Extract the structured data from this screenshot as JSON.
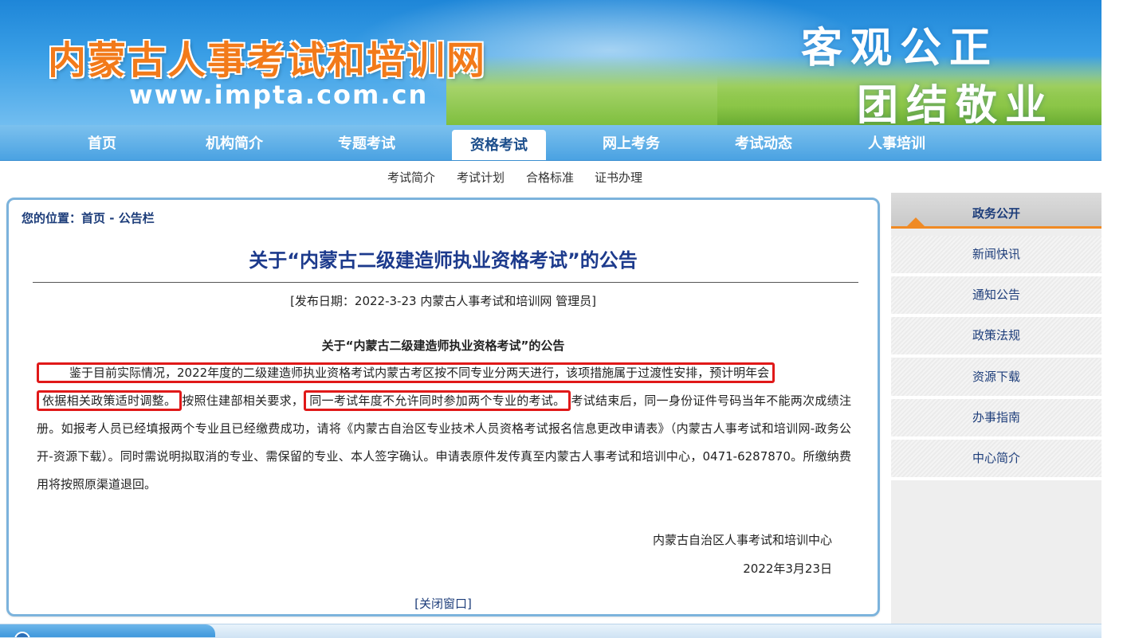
{
  "header": {
    "site_title": "内蒙古人事考试和培训网",
    "site_url": "www.impta.com.cn",
    "slogan_line1": "客观公正",
    "slogan_line2": "团结敬业"
  },
  "main_nav": {
    "items": [
      "首页",
      "机构简介",
      "专题考试",
      "资格考试",
      "网上考务",
      "考试动态",
      "人事培训"
    ],
    "active": "资格考试"
  },
  "sub_nav": {
    "items": [
      "考试简介",
      "考试计划",
      "合格标准",
      "证书办理"
    ]
  },
  "breadcrumb": {
    "prefix": "您的位置：",
    "home": "首页",
    "separator": " - ",
    "current": "公告栏"
  },
  "article": {
    "title": "关于“内蒙古二级建造师执业资格考试”的公告",
    "meta": "[发布日期：2022-3-23 内蒙古人事考试和培训网 管理员]",
    "subtitle": "关于“内蒙古二级建造师执业资格考试”的公告",
    "para_part1": "鉴于目前实际情况，2022年度的二级建造师执业资格考试内蒙古考区按不同专业分两天进行，该项措施属于过渡性安排，预计明年会",
    "para_part2": "依据相关政策适时调整。",
    "para_part3": "按照住建部相关要求，",
    "para_part4": "同一考试年度不允许同时参加两个专业的考试。",
    "para_part5": "考试结束后，同一身份证件号码当年不能两次成绩注册。如报考人员已经填报两个专业且已经缴费成功，请将《内蒙古自治区专业技术人员资格考试报名信息更改申请表》（内蒙古人事考试和培训网-政务公开-资源下载）。同时需说明拟取消的专业、需保留的专业、本人签字确认。申请表原件发传真至内蒙古人事考试和培训中心，0471-6287870。所缴纳费用将按照原渠道退回。",
    "signature": "内蒙古自治区人事考试和培训中心",
    "date": "2022年3月23日",
    "close_link": "[关闭窗口]"
  },
  "sidebar": {
    "header": "政务公开",
    "items": [
      "新闻快讯",
      "通知公告",
      "政策法规",
      "资源下载",
      "办事指南",
      "中心简介"
    ]
  },
  "colors": {
    "nav_blue": "#4aa2e2",
    "title_blue": "#1c3a8c",
    "highlight_red": "#e01919",
    "title_orange": "#f27a1a",
    "sidebar_accent": "#f08a24"
  }
}
